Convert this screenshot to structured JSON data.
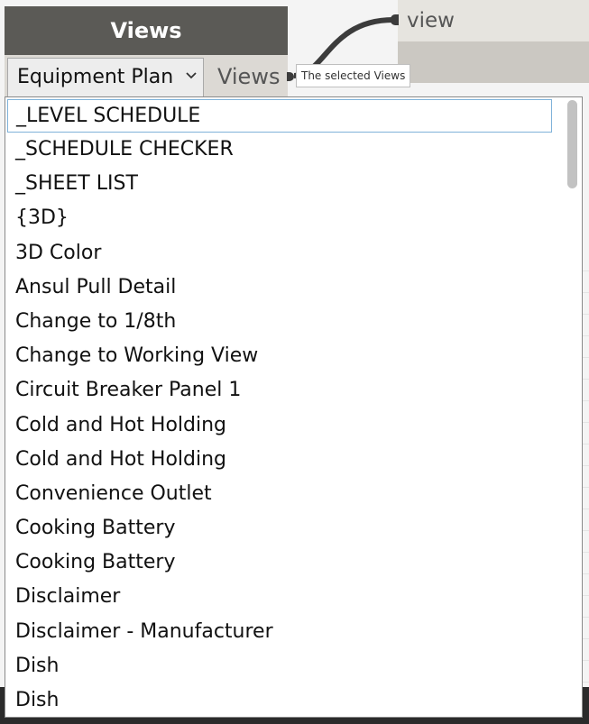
{
  "views_node": {
    "title": "Views",
    "selected_value": "Equipment Plan",
    "output_port_label": "Views"
  },
  "tooltip": {
    "text": "The selected Views"
  },
  "target_node": {
    "label": "view"
  },
  "dropdown": {
    "options": [
      "_LEVEL SCHEDULE",
      "_SCHEDULE CHECKER",
      "_SHEET LIST",
      "{3D}",
      "3D Color",
      "Ansul Pull Detail",
      "Change to 1/8th",
      "Change to Working View",
      "Circuit Breaker Panel 1",
      "Cold and Hot Holding",
      "Cold and Hot Holding",
      "Convenience Outlet",
      "Cooking Battery",
      "Cooking Battery",
      "Disclaimer",
      "Disclaimer - Manufacturer",
      "Dish",
      "Dish"
    ],
    "highlighted_option": "_LEVEL SCHEDULE"
  },
  "colors": {
    "node_header": "#5b5a56",
    "node_body": "#dcd9d4",
    "highlight_border": "#7fb2d9",
    "wire": "#3c3c3c"
  },
  "icons": {
    "dropdown": "chevron-down-icon",
    "scroll": "scrollbar-thumb"
  }
}
